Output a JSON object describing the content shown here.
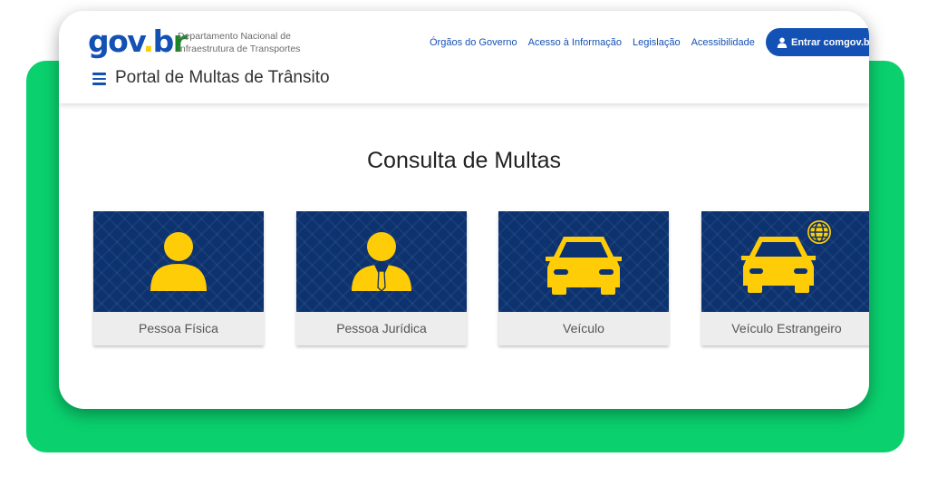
{
  "logo": {
    "part1": "gov",
    "dot": ".",
    "part2": "b",
    "part3": "r"
  },
  "department": {
    "line1": "Departamento Nacional de",
    "line2": "Infraestrutura de Transportes"
  },
  "nav": [
    {
      "label": "Órgãos do Governo"
    },
    {
      "label": "Acesso à Informação"
    },
    {
      "label": "Legislação"
    },
    {
      "label": "Acessibilidade"
    }
  ],
  "login": {
    "label_prefix": "Entrar com ",
    "label_brand": "gov.br"
  },
  "portal": {
    "title": "Portal de Multas de Trânsito"
  },
  "main": {
    "title": "Consulta de Multas",
    "tiles": [
      {
        "label": "Pessoa Física",
        "icon": "person-icon"
      },
      {
        "label": "Pessoa Jurídica",
        "icon": "business-person-icon"
      },
      {
        "label": "Veículo",
        "icon": "car-icon"
      },
      {
        "label": "Veículo Estrangeiro",
        "icon": "foreign-car-icon"
      }
    ]
  },
  "colors": {
    "primary_blue": "#1351b4",
    "tile_blue": "#0c326f",
    "icon_yellow": "#ffcd07",
    "frame_green": "#0ad16e"
  }
}
